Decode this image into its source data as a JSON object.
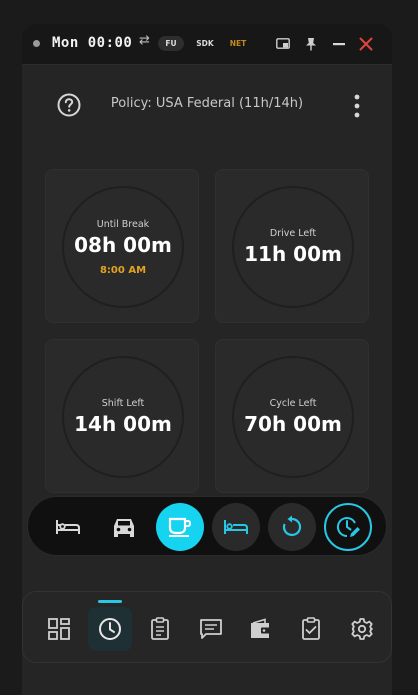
{
  "titlebar": {
    "clock": "Mon 00:00",
    "badges": {
      "fu": "FU",
      "sdk": "SDK",
      "net": "NET"
    }
  },
  "header": {
    "policy": "Policy: USA Federal (11h/14h)"
  },
  "cards": [
    {
      "label": "Until Break",
      "value": "08h 00m",
      "sub": "8:00 AM"
    },
    {
      "label": "Drive Left",
      "value": "11h 00m"
    },
    {
      "label": "Shift Left",
      "value": "14h 00m"
    },
    {
      "label": "Cycle Left",
      "value": "70h 00m"
    }
  ],
  "status_bar": {
    "selected": "on-break",
    "items": [
      "off-duty-icon",
      "driving-icon",
      "on-break-icon",
      "sleeper-berth-icon",
      "cycle-reset-icon",
      "edit-time-icon"
    ]
  },
  "nav": {
    "active": "clock",
    "items": [
      "dashboard-icon",
      "clock-icon",
      "logs-icon",
      "messages-icon",
      "wallet-icon",
      "checklist-icon",
      "settings-icon"
    ]
  },
  "colors": {
    "accent": "#29c7e6",
    "warning": "#e3a321",
    "close": "#e0443e",
    "background": "#252525",
    "card": "#2a2a2a"
  }
}
